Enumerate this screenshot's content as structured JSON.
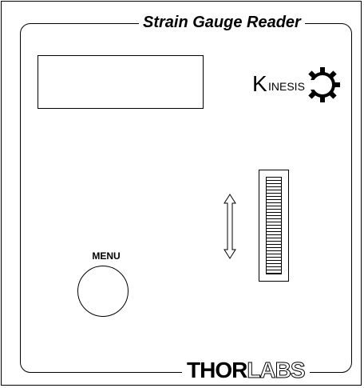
{
  "device": {
    "title": "Strain Gauge Reader",
    "display": {
      "text": ""
    },
    "menu": {
      "label": "MENU"
    },
    "logo": {
      "name": "kinesis-logo",
      "text": "KINESIS"
    },
    "brand": {
      "primary": "THOR",
      "secondary": "LABS"
    },
    "colors": {
      "ink": "#000000",
      "paper": "#ffffff"
    }
  }
}
